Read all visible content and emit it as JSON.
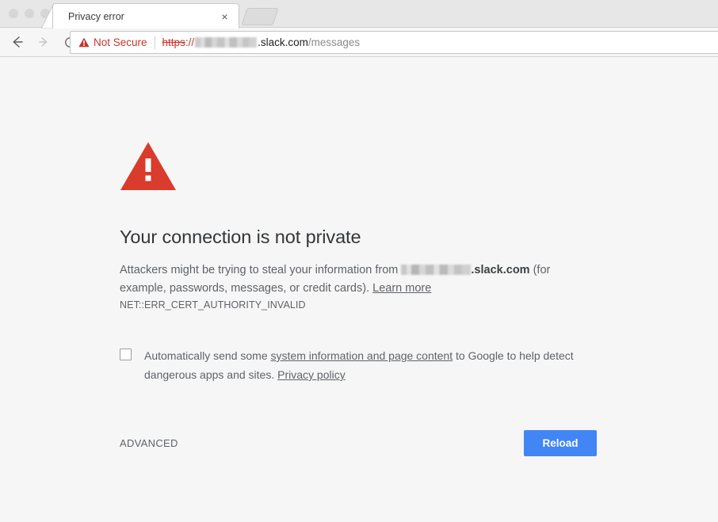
{
  "window": {
    "traffic_lights": [
      "close",
      "minimize",
      "zoom"
    ]
  },
  "tabs": [
    {
      "title": "Privacy error",
      "close_label": "×",
      "active": true
    }
  ],
  "newtab": {
    "label": ""
  },
  "toolbar": {
    "back_label": "Back",
    "forward_label": "Forward",
    "reload_label": "Reload page",
    "security_badge": "Not Secure",
    "url": {
      "scheme": "https",
      "separator": "://",
      "subdomain_redacted": true,
      "host": ".slack.com",
      "path": "/messages"
    }
  },
  "page": {
    "icon": "warning-triangle-icon",
    "headline": "Your connection is not private",
    "body_before": "Attackers might be trying to steal your information from ",
    "body_host": ".slack.com",
    "body_after": " (for example, passwords, messages, or credit cards). ",
    "learn_more": "Learn more",
    "error_code": "NET::ERR_CERT_AUTHORITY_INVALID",
    "optin_before": "Automatically send some ",
    "optin_link1": "system information and page content",
    "optin_middle": " to Google to help detect dangerous apps and sites. ",
    "optin_link2": "Privacy policy",
    "optin_checked": false,
    "advanced_label": "ADVANCED",
    "reload_label": "Reload"
  },
  "colors": {
    "warning_red": "#d93b2c",
    "not_secure_red": "#c5352b",
    "button_blue": "#4285f4",
    "page_background": "#f6f6f6",
    "text_grey": "#5f6368",
    "heading_grey": "#333639"
  }
}
